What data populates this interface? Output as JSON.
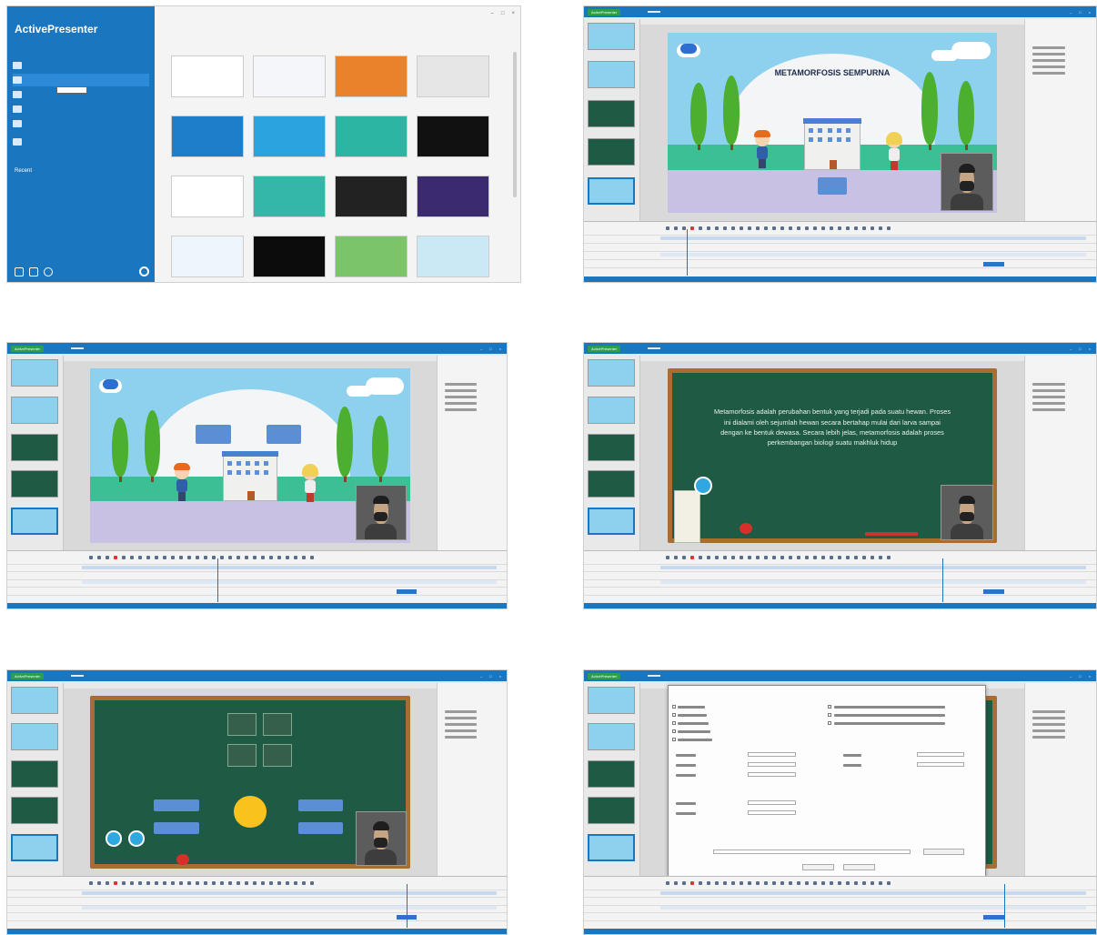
{
  "start": {
    "logo": "ActivePresenter",
    "menu": [
      "",
      "",
      "",
      "",
      "",
      ""
    ],
    "recent_label": "Recent",
    "tabs": [
      "",
      "",
      ""
    ],
    "templates": [
      {
        "name": "",
        "label": "",
        "bg": "#ffffff"
      },
      {
        "name": "",
        "label": "",
        "bg": "#f4f6f9"
      },
      {
        "name": "",
        "label": "",
        "bg": "#e8822b"
      },
      {
        "name": "",
        "label": "",
        "bg": "#e6e6e6"
      },
      {
        "name": "",
        "label": "",
        "bg": "#1e7ec9"
      },
      {
        "name": "",
        "label": "",
        "bg": "#2aa3de"
      },
      {
        "name": "",
        "label": "",
        "bg": "#2db5a4"
      },
      {
        "name": "",
        "label": "",
        "bg": "#111111"
      },
      {
        "name": "",
        "label": "",
        "bg": "#ffffff"
      },
      {
        "name": "",
        "label": "",
        "bg": "#34b7a8"
      },
      {
        "name": "",
        "label": "",
        "bg": "#222222"
      },
      {
        "name": "",
        "label": "",
        "bg": "#3b2a6e"
      },
      {
        "name": "",
        "label": "",
        "bg": "#eef6fb"
      },
      {
        "name": "",
        "label": "",
        "bg": "#0c0c0c"
      },
      {
        "name": "",
        "label": "",
        "bg": "#7cc46a"
      },
      {
        "name": "",
        "label": "",
        "bg": "#cbe9f5"
      }
    ]
  },
  "editor": {
    "app_name": "ActivePresenter",
    "ribbon_tabs": [
      "",
      "",
      "",
      "",
      "",
      "",
      "",
      "",
      "",
      ""
    ]
  },
  "slide_title": {
    "line1": "METAMORFOSIS SEMPURNA",
    "line2": ""
  },
  "board_text": "Metamorfosis adalah perubahan bentuk yang terjadi pada suatu hewan. Proses ini dialami oleh sejumlah hewan secara bertahap mulai dari larva sampai dengan ke bentuk dewasa. Secara lebih jelas, metamorfosis adalah proses perkembangan biologi suatu makhluk hidup",
  "quiz_question": "",
  "dialog_title": "",
  "colors": {
    "ribbon": "#1b76c0",
    "start_sidebar": "#1b76c0",
    "sky": "#8ed1ee",
    "grass": "#3dbf95",
    "chalkboard": "#1f5a45",
    "board_frame": "#a86d33"
  }
}
